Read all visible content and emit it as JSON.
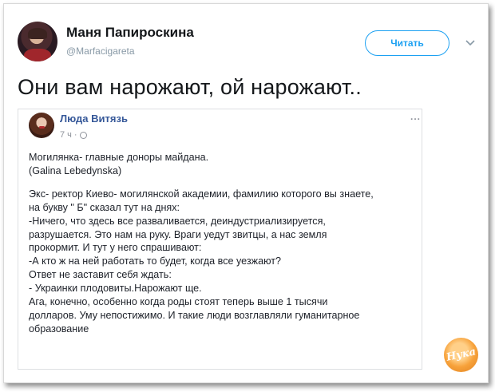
{
  "tweet": {
    "author_name": "Маня Папироскина",
    "author_handle": "@Marfacigareta",
    "follow_label": "Читать",
    "text": "Они вам нарожают, ой нарожают.."
  },
  "embedded_post": {
    "author_name": "Люда Витязь",
    "time": "7 ч",
    "more": "...",
    "lines": [
      "Могилянка- главные доноры майдана.",
      "(Galina Lebedynska)",
      "",
      "Экс- ректор Киево- могилянской академии, фамилию которого вы знаете,",
      "на букву \" Б\" сказал тут на днях:",
      "-Ничего, что здесь все разваливается, деиндустриализируется,",
      "разрушается. Это нам на руку. Враги уедут звитцы, а нас земля",
      "прокормит. И тут у него спрашивают:",
      "-А кто ж на ней работать то будет, когда все уезжают?",
      "Ответ не заставит себя ждать:",
      "- Украинки плодовиты.Нарожают ще.",
      "Ага, конечно, особенно когда роды стоят теперь выше 1 тысячи",
      "долларов. Уму непостижимо. И такие люди возглавляли гуманитарное",
      "образование"
    ]
  },
  "watermark": {
    "text": "Нука"
  },
  "colors": {
    "accent": "#1da1f2",
    "fb_name": "#365899",
    "logo": "#f7a23b"
  }
}
